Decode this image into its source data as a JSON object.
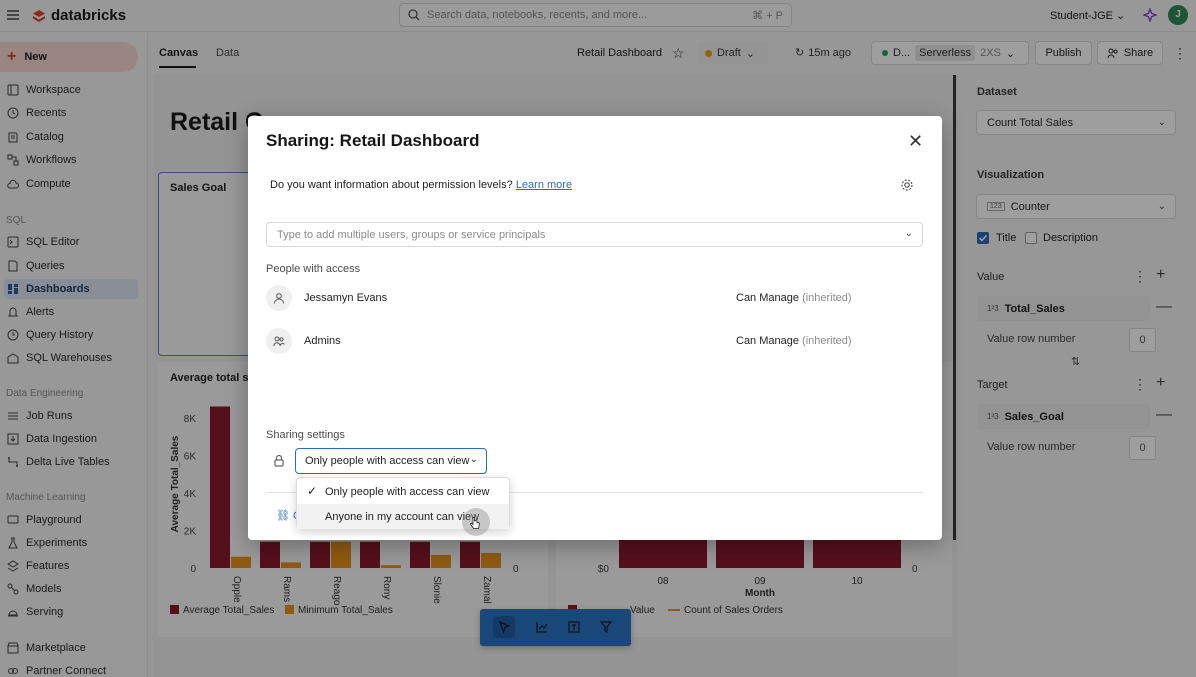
{
  "topbar": {
    "brand": "databricks",
    "search_placeholder": "Search data, notebooks, recents, and more...",
    "search_shortcut": "⌘ + P",
    "user": "Student-JGE ⌄",
    "avatar_initial": "J"
  },
  "sidebar": {
    "new_label": "New",
    "items_top": [
      "Workspace",
      "Recents",
      "Catalog",
      "Workflows",
      "Compute"
    ],
    "sql_header": "SQL",
    "items_sql": [
      "SQL Editor",
      "Queries",
      "Dashboards",
      "Alerts",
      "Query History",
      "SQL Warehouses"
    ],
    "de_header": "Data Engineering",
    "items_de": [
      "Job Runs",
      "Data Ingestion",
      "Delta Live Tables"
    ],
    "ml_header": "Machine Learning",
    "items_ml": [
      "Playground",
      "Experiments",
      "Features",
      "Models",
      "Serving"
    ],
    "items_bottom": [
      "Marketplace",
      "Partner Connect"
    ]
  },
  "header": {
    "tab_canvas": "Canvas",
    "tab_data": "Data",
    "dashboard_title": "Retail Dashboard",
    "draft": "Draft",
    "refresh": "15m ago",
    "compute_name": "D...",
    "compute_type": "Serverless",
    "compute_size": "2XS",
    "publish": "Publish",
    "share": "Share"
  },
  "canvas": {
    "big_title": "Retail C",
    "sales_goal": "Sales Goal",
    "avg_title": "Average total sa"
  },
  "chart_data": [
    {
      "type": "bar",
      "title": "Average total sa",
      "ylabel": "Average Total_Sales",
      "yticks": [
        "8K",
        "6K",
        "4K",
        "2K",
        "0"
      ],
      "y2ticks": [
        "0"
      ],
      "ylim": [
        0,
        9000
      ],
      "categories": [
        "Opple",
        "Rams",
        "Reago",
        "Rony",
        "Slonie",
        "Zamal"
      ],
      "series": [
        {
          "name": "Average Total_Sales",
          "color": "#8b1a2e",
          "values": [
            8600,
            1400,
            1400,
            1400,
            1400,
            1400
          ]
        },
        {
          "name": "Minimum Total_Sales",
          "color": "#e8941c",
          "values": [
            600,
            300,
            1400,
            150,
            700,
            800
          ]
        }
      ]
    },
    {
      "type": "bar",
      "xlabel": "Month",
      "yticks": [
        "$0"
      ],
      "y2ticks": [
        "0"
      ],
      "categories": [
        "08",
        "09",
        "10"
      ],
      "series": [
        {
          "name": "Total Sales Value",
          "color": "#8b1a2e",
          "values": [
            1,
            1,
            1
          ]
        },
        {
          "name": "Count of Sales Orders",
          "color": "#e8941c",
          "values": []
        }
      ],
      "legend_visible": [
        "Value",
        "Count of Sales Orders"
      ]
    }
  ],
  "right_panel": {
    "dataset_label": "Dataset",
    "dataset_value": "Count Total Sales",
    "viz_label": "Visualization",
    "viz_value": "Counter",
    "viz_badge": "123",
    "title_cb": "Title",
    "desc_cb": "Description",
    "value_label": "Value",
    "value_field": "Total_Sales",
    "value_row_label": "Value row number",
    "value_row": "0",
    "target_label": "Target",
    "target_field": "Sales_Goal",
    "target_row_label": "Value row number",
    "target_row": "0",
    "field_type_icon": "1²3"
  },
  "modal": {
    "title": "Sharing: Retail Dashboard",
    "perm_question": "Do you want information about permission levels?",
    "learn_more": "Learn more",
    "add_placeholder": "Type to add multiple users, groups or service principals",
    "people_label": "People with access",
    "people": [
      {
        "name": "Jessamyn Evans",
        "perm": "Can Manage",
        "note": "(inherited)"
      },
      {
        "name": "Admins",
        "perm": "Can Manage",
        "note": "(inherited)"
      }
    ],
    "sharing_label": "Sharing settings",
    "sharing_value": "Only people with access can view",
    "copy_link": "C",
    "options": [
      "Only people with access can view",
      "Anyone in my account can view"
    ]
  },
  "colors": {
    "accent": "#2a6db8",
    "brand": "#d3412b",
    "bar_primary": "#8b1a2e",
    "bar_secondary": "#e8941c"
  }
}
